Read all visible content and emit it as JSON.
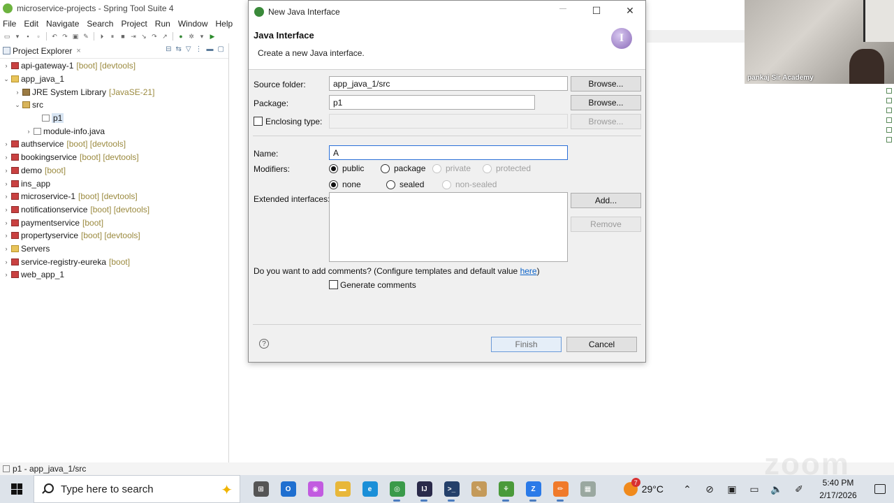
{
  "window": {
    "title": "microservice-projects - Spring Tool Suite 4"
  },
  "menu": [
    "File",
    "Edit",
    "Navigate",
    "Search",
    "Project",
    "Run",
    "Window",
    "Help"
  ],
  "explorer": {
    "tab_label": "Project Explorer",
    "tab_close": "×",
    "items": [
      {
        "label": "api-gateway-1",
        "decor": "[boot] [devtools]",
        "twisty": "›",
        "icon": "boot"
      },
      {
        "label": "app_java_1",
        "decor": "",
        "twisty": "⌄",
        "icon": "folder"
      },
      {
        "label": "JRE System Library",
        "decor": "[JavaSE-21]",
        "twisty": "›",
        "icon": "lib"
      },
      {
        "label": "src",
        "decor": "",
        "twisty": "⌄",
        "icon": "src"
      },
      {
        "label": "p1",
        "decor": "",
        "twisty": "",
        "icon": "pkg"
      },
      {
        "label": "module-info.java",
        "decor": "",
        "twisty": "›",
        "icon": "java"
      },
      {
        "label": "authservice",
        "decor": "[boot] [devtools]",
        "twisty": "›",
        "icon": "boot"
      },
      {
        "label": "bookingservice",
        "decor": "[boot] [devtools]",
        "twisty": "›",
        "icon": "boot"
      },
      {
        "label": "demo",
        "decor": "[boot]",
        "twisty": "›",
        "icon": "boot"
      },
      {
        "label": "ins_app",
        "decor": "",
        "twisty": "›",
        "icon": "boot"
      },
      {
        "label": "microservice-1",
        "decor": "[boot] [devtools]",
        "twisty": "›",
        "icon": "boot"
      },
      {
        "label": "notificationservice",
        "decor": "[boot] [devtools]",
        "twisty": "›",
        "icon": "boot"
      },
      {
        "label": "paymentservice",
        "decor": "[boot]",
        "twisty": "›",
        "icon": "boot"
      },
      {
        "label": "propertyservice",
        "decor": "[boot] [devtools]",
        "twisty": "›",
        "icon": "boot"
      },
      {
        "label": "Servers",
        "decor": "",
        "twisty": "›",
        "icon": "folder"
      },
      {
        "label": "service-registry-eureka",
        "decor": "[boot]",
        "twisty": "›",
        "icon": "boot"
      },
      {
        "label": "web_app_1",
        "decor": "",
        "twisty": "›",
        "icon": "boot"
      }
    ]
  },
  "status": {
    "text": "p1 - app_java_1/src"
  },
  "webcam": {
    "name": "pankaj Sir Academy"
  },
  "zoom_watermark": "zoom",
  "dialog": {
    "title": "New Java Interface",
    "header_title": "Java Interface",
    "header_desc": "Create a new Java interface.",
    "header_icon": "I",
    "source_folder_label": "Source folder:",
    "source_folder_value": "app_java_1/src",
    "package_label": "Package:",
    "package_value": "p1",
    "enclosing_label": "Enclosing type:",
    "enclosing_value": "",
    "browse_label": "Browse...",
    "name_label": "Name:",
    "name_value": "A",
    "modifiers_label": "Modifiers:",
    "modifiers_row1": [
      {
        "label": "public",
        "checked": true,
        "disabled": false
      },
      {
        "label": "package",
        "checked": false,
        "disabled": false
      },
      {
        "label": "private",
        "checked": false,
        "disabled": true
      },
      {
        "label": "protected",
        "checked": false,
        "disabled": true
      }
    ],
    "modifiers_row2": [
      {
        "label": "none",
        "checked": true,
        "disabled": false
      },
      {
        "label": "sealed",
        "checked": false,
        "disabled": false
      },
      {
        "label": "non-sealed",
        "checked": false,
        "disabled": true
      }
    ],
    "extended_label": "Extended interfaces:",
    "add_label": "Add...",
    "remove_label": "Remove",
    "comments_question": "Do you want to add comments? (Configure templates and default value ",
    "comments_link": "here",
    "comments_close": ")",
    "generate_comments_label": "Generate comments",
    "help_symbol": "?",
    "finish_label": "Finish",
    "cancel_label": "Cancel"
  },
  "taskbar": {
    "search_placeholder": "Type here to search",
    "weather_temp": "29°C",
    "weather_badge": "7",
    "time": "5:40 PM",
    "date": "2/17/2026",
    "apps": [
      {
        "name": "task-view-icon",
        "color": "#555555",
        "glyph": "⊞"
      },
      {
        "name": "outlook-icon",
        "color": "#1f6fd0",
        "glyph": "O"
      },
      {
        "name": "copilot-icon",
        "color": "#c25be0",
        "glyph": "◉"
      },
      {
        "name": "file-explorer-icon",
        "color": "#e8b73a",
        "glyph": "▬"
      },
      {
        "name": "edge-icon",
        "color": "#1a8fd8",
        "glyph": "e"
      },
      {
        "name": "chrome-icon",
        "color": "#3a9a4a",
        "glyph": "◎"
      },
      {
        "name": "intellij-icon",
        "color": "#2a2a4a",
        "glyph": "IJ"
      },
      {
        "name": "terminal-icon",
        "color": "#24406a",
        "glyph": ">_"
      },
      {
        "name": "paint-icon",
        "color": "#c49a5a",
        "glyph": "✎"
      },
      {
        "name": "spring-tool-suite-icon",
        "color": "#4a9a3a",
        "glyph": "⚘"
      },
      {
        "name": "zoom-icon",
        "color": "#2a7ae8",
        "glyph": "Z"
      },
      {
        "name": "annotate-icon",
        "color": "#f07a2a",
        "glyph": "✏"
      },
      {
        "name": "gallery-icon",
        "color": "#9aa8a0",
        "glyph": "▦"
      }
    ]
  }
}
